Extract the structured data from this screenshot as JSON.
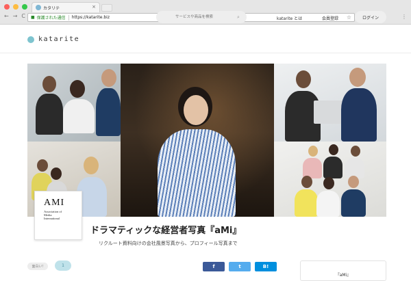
{
  "browser": {
    "tab_title": "カタリテ",
    "tab_close": "×",
    "nav_back": "←",
    "nav_forward": "→",
    "nav_reload": "C",
    "secure_label": "保護された通信",
    "url": "https://katarite.biz",
    "bookmark": "☆",
    "menu": "⋮"
  },
  "header": {
    "logo_text": "katarite",
    "search_placeholder": "サービスや商品を検索",
    "nav_about": "katarite とは",
    "nav_register": "会員登録",
    "login": "ログイン"
  },
  "hero": {
    "org_logo": "AMI",
    "org_name": "Association of\nMedia\nInternational"
  },
  "article": {
    "title": "ドラマティックな経営者写真『aMi』",
    "subtitle": "リクルート資料向けの会社風景写真から、プロフィール写真まで",
    "like_label": "面白い!",
    "like_count": "1",
    "share_facebook": "f",
    "share_twitter": "t",
    "share_hatena": "B!",
    "sidebox_title": "『aMi』"
  },
  "colors": {
    "accent": "#7ec4cf",
    "facebook": "#3b5998",
    "twitter": "#55acee",
    "hatena": "#008fde"
  }
}
